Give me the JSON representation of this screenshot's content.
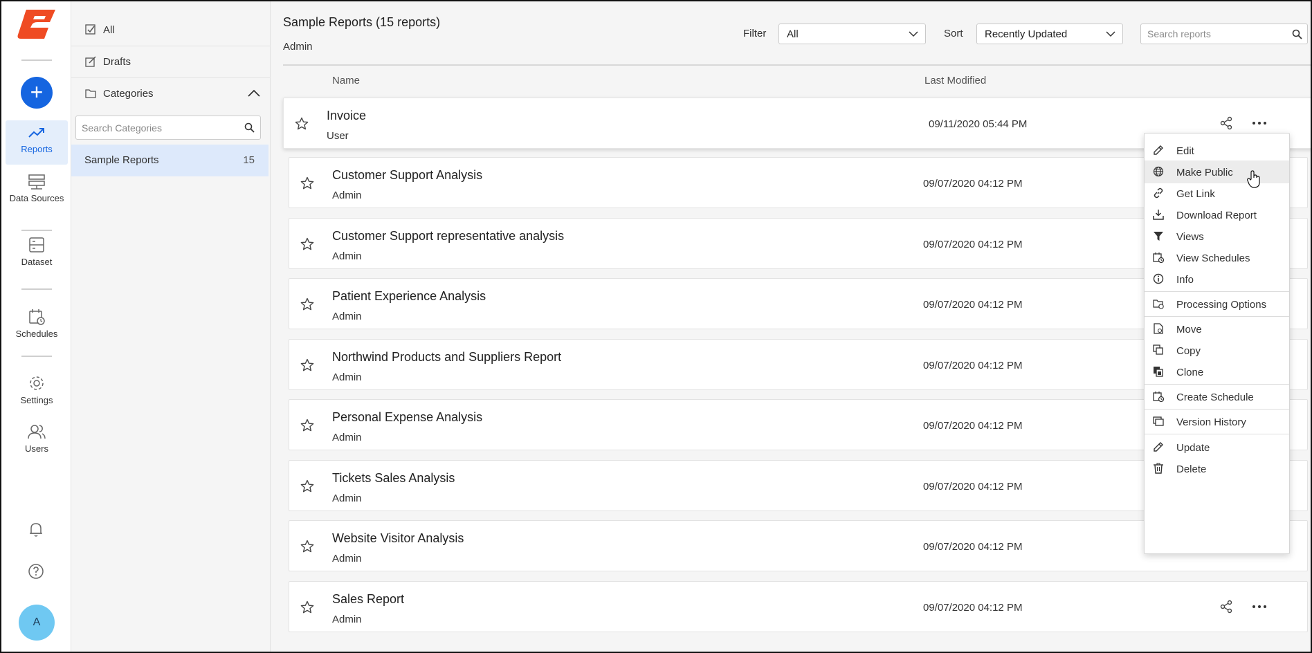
{
  "nav": {
    "items": [
      {
        "label": "Reports",
        "icon": "trending-up-icon"
      },
      {
        "label": "Data Sources",
        "icon": "server-icon"
      },
      {
        "label": "Dataset",
        "icon": "dataset-icon"
      },
      {
        "label": "Schedules",
        "icon": "calendar-clock-icon"
      },
      {
        "label": "Settings",
        "icon": "gear-icon"
      },
      {
        "label": "Users",
        "icon": "users-icon"
      }
    ],
    "avatar": "A",
    "add_label": "+"
  },
  "categories": {
    "all": "All",
    "drafts": "Drafts",
    "header": "Categories",
    "search_placeholder": "Search Categories",
    "selected": {
      "label": "Sample Reports",
      "count": "15"
    }
  },
  "main": {
    "title": "Sample Reports (15 reports)",
    "subtitle": "Admin",
    "filter_label": "Filter",
    "filter_value": "All",
    "sort_label": "Sort",
    "sort_value": "Recently Updated",
    "search_placeholder": "Search reports",
    "col_name": "Name",
    "col_modified": "Last Modified"
  },
  "reports": [
    {
      "name": "Invoice",
      "owner": "User",
      "modified": "09/11/2020 05:44 PM"
    },
    {
      "name": "Customer Support Analysis",
      "owner": "Admin",
      "modified": "09/07/2020 04:12 PM"
    },
    {
      "name": "Customer Support representative analysis",
      "owner": "Admin",
      "modified": "09/07/2020 04:12 PM"
    },
    {
      "name": "Patient Experience Analysis",
      "owner": "Admin",
      "modified": "09/07/2020 04:12 PM"
    },
    {
      "name": "Northwind Products and Suppliers Report",
      "owner": "Admin",
      "modified": "09/07/2020 04:12 PM"
    },
    {
      "name": "Personal Expense Analysis",
      "owner": "Admin",
      "modified": "09/07/2020 04:12 PM"
    },
    {
      "name": "Tickets Sales Analysis",
      "owner": "Admin",
      "modified": "09/07/2020 04:12 PM"
    },
    {
      "name": "Website Visitor Analysis",
      "owner": "Admin",
      "modified": "09/07/2020 04:12 PM"
    },
    {
      "name": "Sales Report",
      "owner": "Admin",
      "modified": "09/07/2020 04:12 PM"
    }
  ],
  "menu": {
    "items": [
      {
        "label": "Edit",
        "icon": "pencil-icon"
      },
      {
        "label": "Make Public",
        "icon": "globe-icon"
      },
      {
        "label": "Get Link",
        "icon": "link-icon"
      },
      {
        "label": "Download Report",
        "icon": "download-icon"
      },
      {
        "label": "Views",
        "icon": "filter-icon"
      },
      {
        "label": "View Schedules",
        "icon": "calendar-clock-icon"
      },
      {
        "label": "Info",
        "icon": "info-icon"
      },
      {
        "label": "Processing Options",
        "icon": "folder-clock-icon"
      },
      {
        "label": "Move",
        "icon": "move-file-icon"
      },
      {
        "label": "Copy",
        "icon": "copy-icon"
      },
      {
        "label": "Clone",
        "icon": "clone-icon"
      },
      {
        "label": "Create Schedule",
        "icon": "calendar-clock-icon"
      },
      {
        "label": "Version History",
        "icon": "version-history-icon"
      },
      {
        "label": "Update",
        "icon": "pencil-icon"
      },
      {
        "label": "Delete",
        "icon": "trash-icon"
      }
    ]
  },
  "colors": {
    "accent": "#1565e0",
    "brand": "#ef4b23",
    "selected_bg": "#dde9fb"
  }
}
